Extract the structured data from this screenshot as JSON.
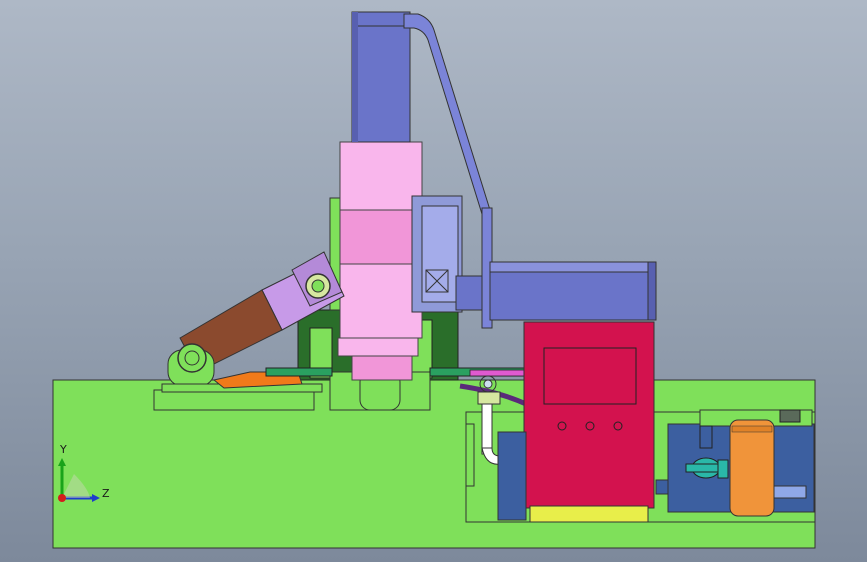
{
  "viewport": {
    "background_top": "#aeb8c6",
    "background_bottom": "#7d899b"
  },
  "triad": {
    "y_label": "Y",
    "z_label": "Z",
    "y_color": "#1aa31a",
    "z_color": "#1e3ccc",
    "origin_color": "#d41c1c"
  },
  "colors": {
    "base": "#7fe05a",
    "cylinder_blue": "#6a74c9",
    "pink_body": "#f9b6ec",
    "purple_arm": "#c79ae8",
    "brown_arm": "#8b4a2e",
    "control_box": "#d3124e",
    "tank_blue": "#3c5fa0",
    "tank_orange": "#f0943a",
    "dark_green": "#2a6e2a",
    "orange_part": "#f07a1a",
    "pipe_magenta": "#e05ad0",
    "pipe_purple": "#5a2a7a",
    "yellow_base": "#e8ee4a"
  },
  "icons": {
    "control_box_buttons": "button-icon",
    "valve": "valve-icon",
    "coordinate_triad": "axis-triad-icon"
  }
}
